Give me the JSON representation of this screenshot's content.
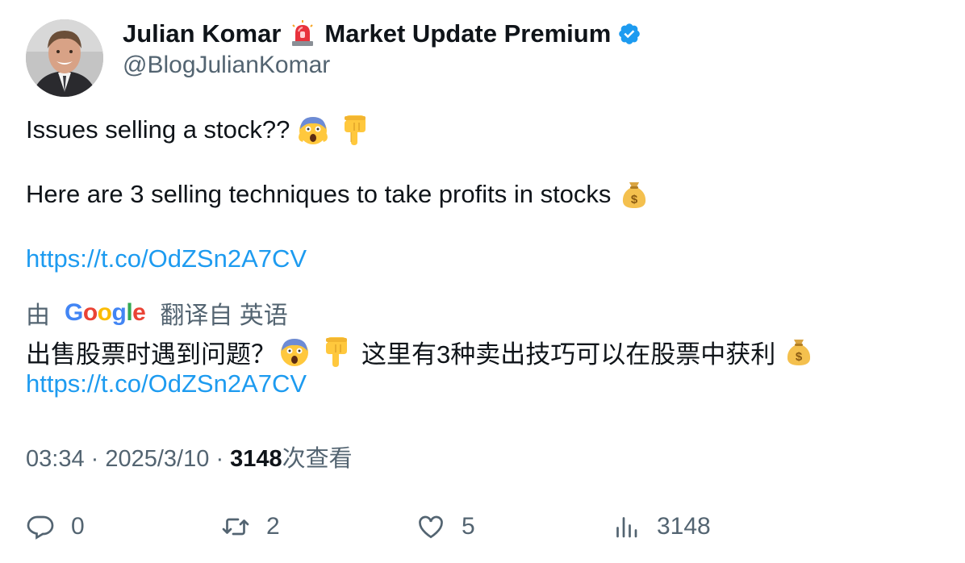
{
  "author": {
    "name": "Julian Komar",
    "name_suffix": "Market Update Premium",
    "handle": "@BlogJulianKomar",
    "verified": true,
    "siren_icon": "siren-icon",
    "verified_icon": "verified-badge-icon"
  },
  "tweet": {
    "line1": "Issues selling a stock??",
    "line2": "Here are 3 selling techniques to take profits in stocks",
    "link": "https://t.co/OdZSn2A7CV"
  },
  "translation": {
    "by": "由",
    "provider": "Google",
    "from_label": "翻译自 英语",
    "text_part1": "出售股票时遇到问题？",
    "text_part2": "这里有3种卖出技巧可以在股票中获利",
    "link": "https://t.co/OdZSn2A7CV"
  },
  "meta": {
    "time": "03:34",
    "sep": "·",
    "date": "2025/3/10",
    "views": "3148",
    "views_label": "次查看"
  },
  "actions": {
    "reply_count": "0",
    "retweet_count": "2",
    "like_count": "5",
    "views_count": "3148"
  },
  "colors": {
    "link": "#1d9bf0",
    "muted": "#536471",
    "text": "#0f1419",
    "verified": "#1d9bf0"
  }
}
